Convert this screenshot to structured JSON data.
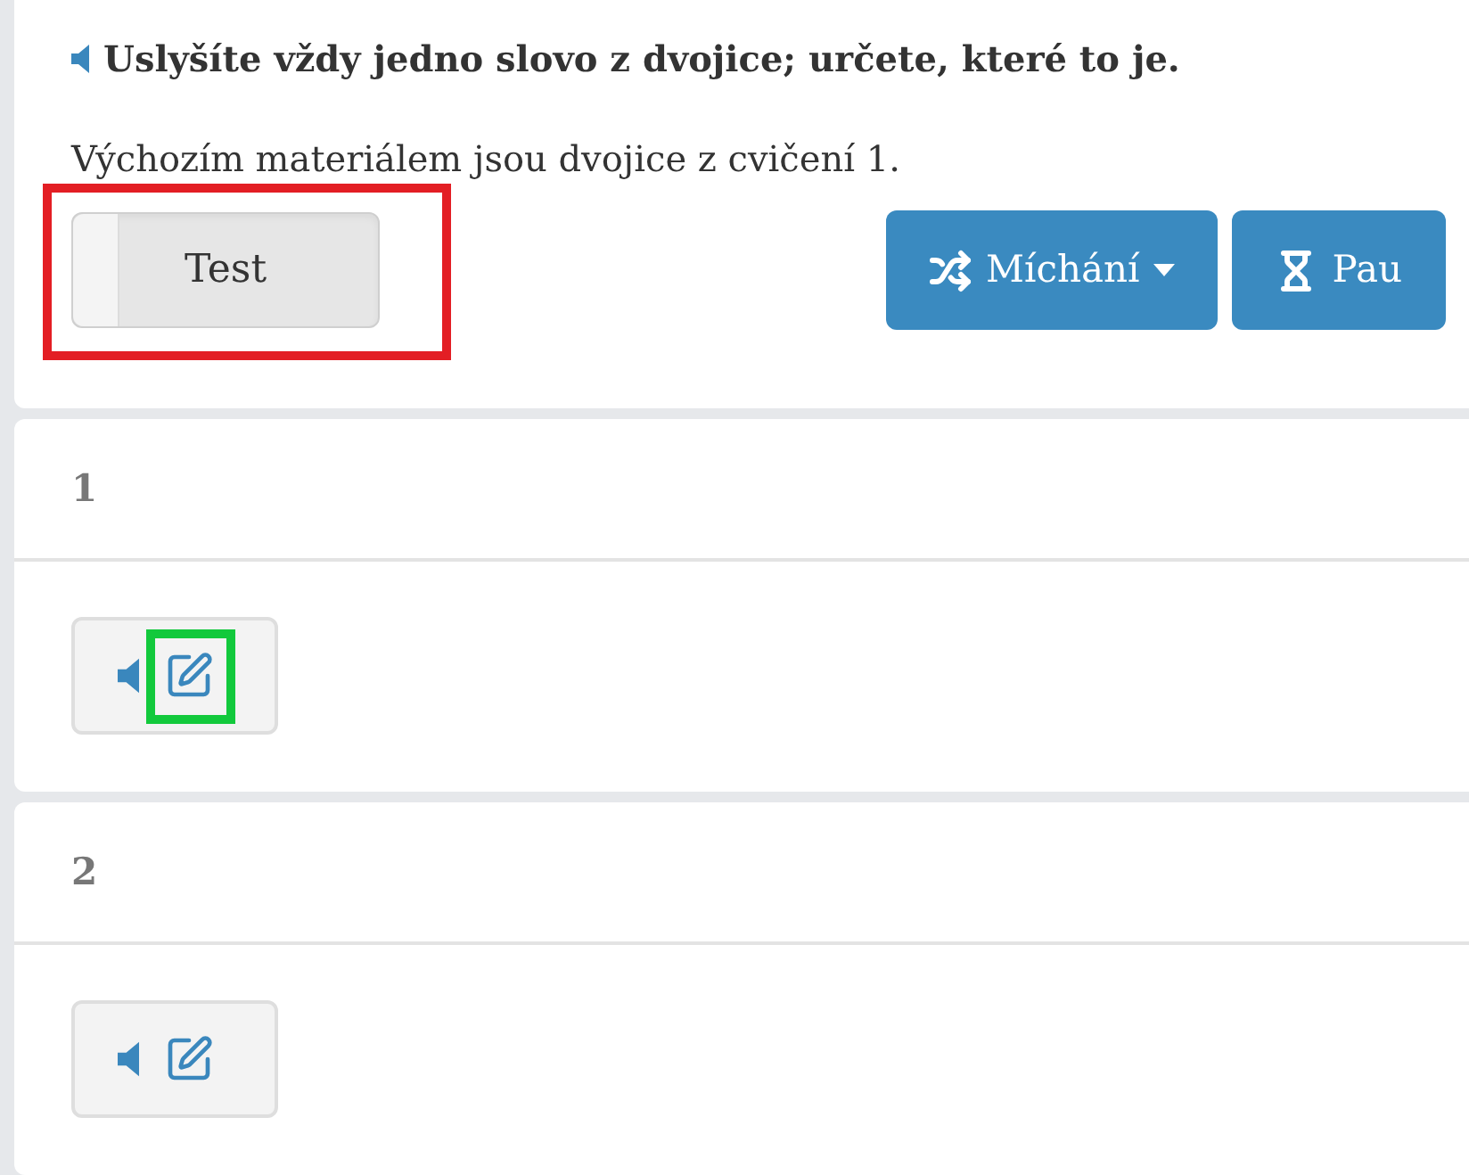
{
  "instruction": {
    "text": "Uslyšíte vždy jedno slovo z dvojice; určete, které to je."
  },
  "description": "Výchozím materiálem jsou dvojice z cvičení 1.",
  "toggle": {
    "label": "Test",
    "on": false,
    "highlighted": true
  },
  "buttons": [
    {
      "label": "Míchání",
      "kind": "dropdown"
    },
    {
      "label": "Pau",
      "kind": "timer"
    }
  ],
  "items": [
    {
      "number": "1",
      "edit_highlighted": true
    },
    {
      "number": "2",
      "edit_highlighted": false
    }
  ]
}
